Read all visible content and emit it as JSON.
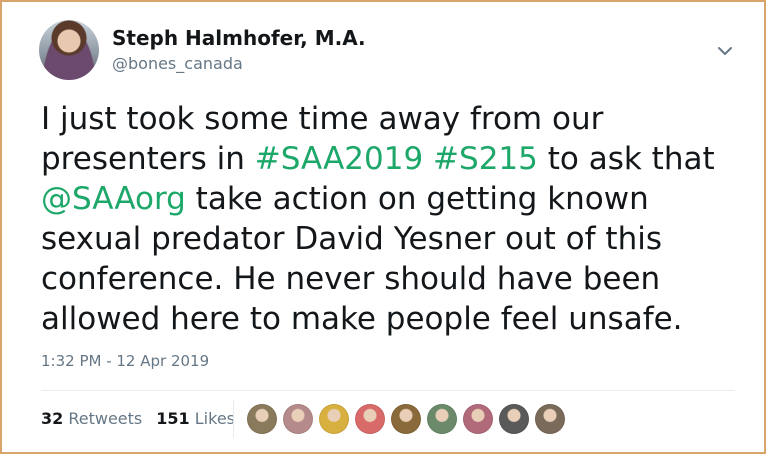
{
  "tweet": {
    "author_name": "Steph Halmhofer, M.A.",
    "handle": "@bones_canada",
    "text_parts": [
      {
        "text": "I just took some time away from our presenters in ",
        "link": false
      },
      {
        "text": "#SAA2019",
        "link": true
      },
      {
        "text": " ",
        "link": false
      },
      {
        "text": "#S215",
        "link": true
      },
      {
        "text": " to ask that ",
        "link": false
      },
      {
        "text": "@SAAorg",
        "link": true
      },
      {
        "text": " take action on getting known sexual predator David Yesner out of this conference. He never should have been allowed here to make people feel unsafe.",
        "link": false
      }
    ],
    "timestamp": "1:32 PM - 12 Apr 2019",
    "retweets_count": "32",
    "retweets_label": "Retweets",
    "likes_count": "151",
    "likes_label": "Likes"
  },
  "icons": {
    "menu": "chevron-down-icon",
    "avatar": "user-avatar"
  },
  "likers": [
    {
      "color": "#8a7a5c"
    },
    {
      "color": "#b58a8a"
    },
    {
      "color": "#d8b040"
    },
    {
      "color": "#d86a6a"
    },
    {
      "color": "#8a6a3a"
    },
    {
      "color": "#6a8a6a"
    },
    {
      "color": "#b06a7a"
    },
    {
      "color": "#5a5a5a"
    },
    {
      "color": "#7a6a5a"
    }
  ],
  "colors": {
    "link": "#1da86a",
    "secondary_text": "#657786",
    "frame_border": "#d9a46a"
  }
}
